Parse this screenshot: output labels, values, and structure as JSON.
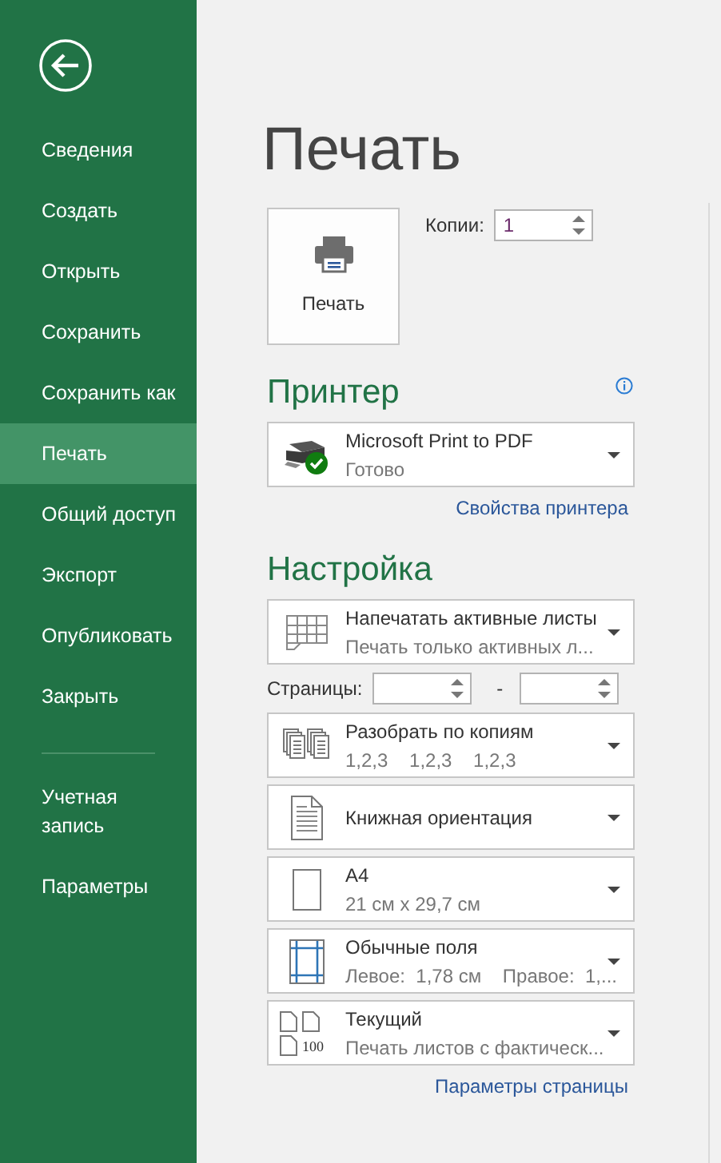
{
  "sidebar": {
    "items": [
      {
        "label": "Сведения",
        "selected": false
      },
      {
        "label": "Создать",
        "selected": false
      },
      {
        "label": "Открыть",
        "selected": false
      },
      {
        "label": "Сохранить",
        "selected": false
      },
      {
        "label": "Сохранить как",
        "selected": false
      },
      {
        "label": "Печать",
        "selected": true
      },
      {
        "label": "Общий доступ",
        "selected": false
      },
      {
        "label": "Экспорт",
        "selected": false
      },
      {
        "label": "Опубликовать",
        "selected": false
      },
      {
        "label": "Закрыть",
        "selected": false
      }
    ],
    "bottom_items": [
      {
        "label": "Учетная запись",
        "selected": false
      },
      {
        "label": "Параметры",
        "selected": false
      }
    ]
  },
  "title": "Печать",
  "print_button": {
    "label": "Печать"
  },
  "copies": {
    "label": "Копии:",
    "value": "1"
  },
  "printer": {
    "heading": "Принтер",
    "name": "Microsoft Print to PDF",
    "status": "Готово",
    "link": "Свойства принтера"
  },
  "settings": {
    "heading": "Настройка",
    "items": [
      {
        "kind": "sheets",
        "title": "Напечатать активные листы",
        "subtitle": "Печать только активных л..."
      },
      {
        "kind": "pages",
        "label": "Страницы:",
        "separator": "-"
      },
      {
        "kind": "collate",
        "title": "Разобрать по копиям",
        "subtitle": "1,2,3    1,2,3    1,2,3"
      },
      {
        "kind": "orientation",
        "title": "Книжная ориентация"
      },
      {
        "kind": "paper",
        "title": "A4",
        "subtitle": "21 см x 29,7 см"
      },
      {
        "kind": "margins",
        "title": "Обычные поля",
        "subtitle": "Левое:  1,78 см    Правое:  1,..."
      },
      {
        "kind": "scaling",
        "title": "Текущий",
        "subtitle": "Печать листов с фактическ...",
        "icon_text": "100"
      }
    ],
    "link": "Параметры страницы"
  }
}
